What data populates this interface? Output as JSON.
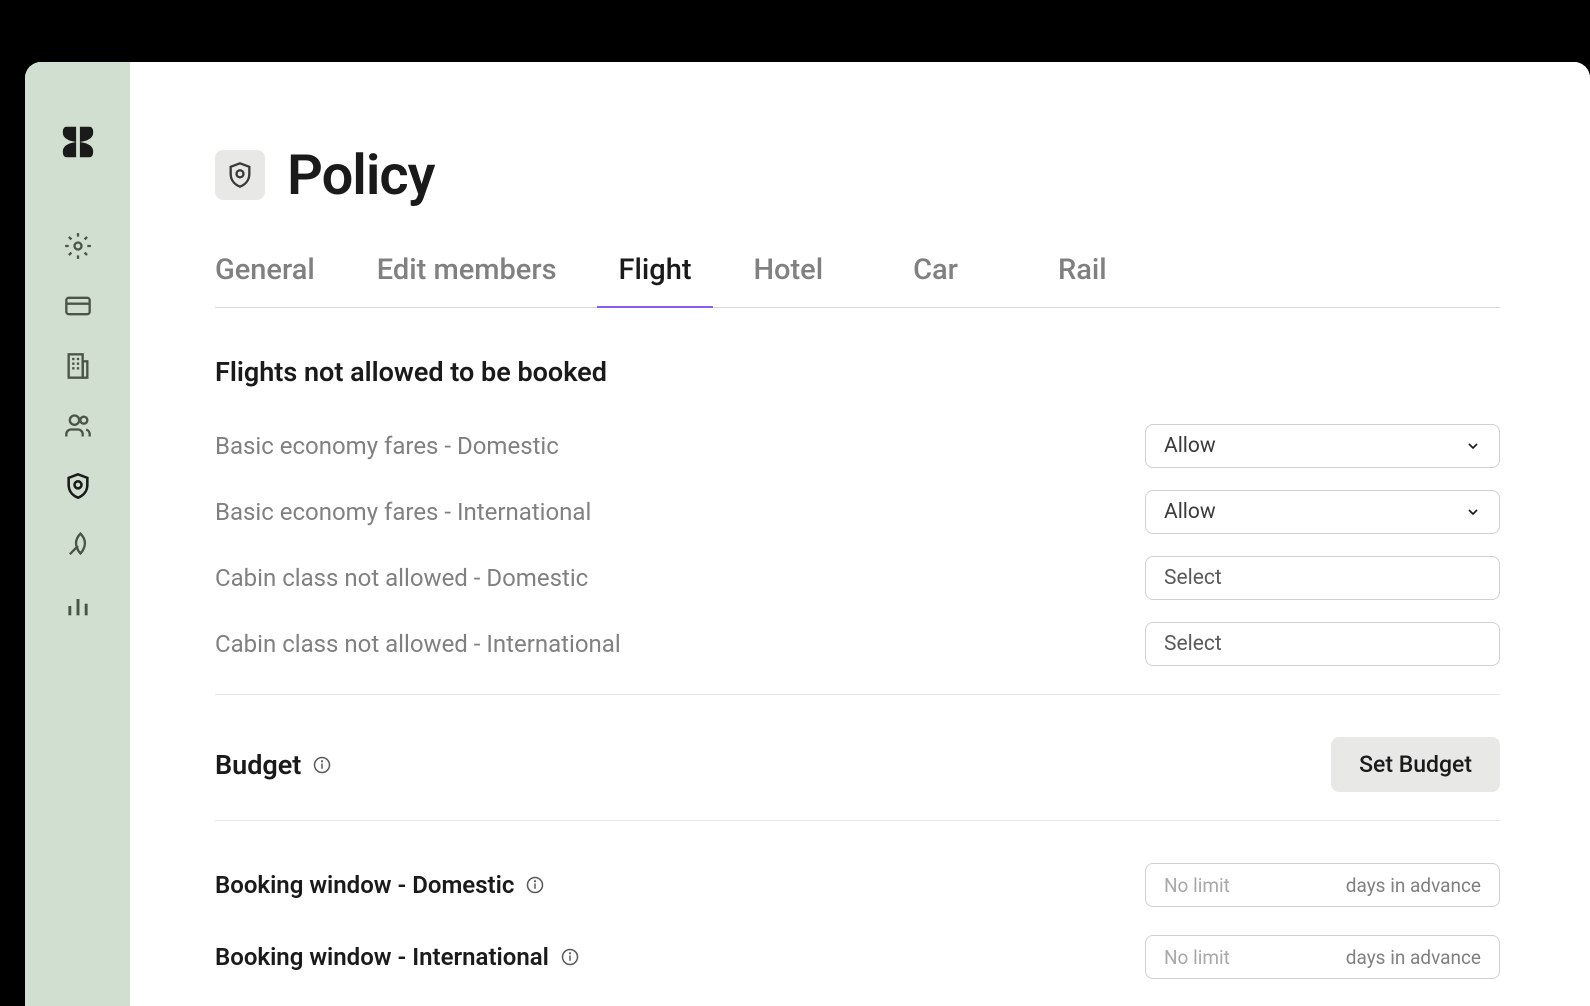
{
  "page": {
    "title": "Policy"
  },
  "tabs": [
    {
      "label": "General",
      "active": false
    },
    {
      "label": "Edit members",
      "active": false
    },
    {
      "label": "Flight",
      "active": true
    },
    {
      "label": "Hotel",
      "active": false
    },
    {
      "label": "Car",
      "active": false
    },
    {
      "label": "Rail",
      "active": false
    }
  ],
  "sections": {
    "not_allowed": {
      "title": "Flights not allowed to be booked",
      "rows": [
        {
          "label": "Basic economy fares - Domestic",
          "value": "Allow",
          "has_chevron": true
        },
        {
          "label": "Basic economy fares - International",
          "value": "Allow",
          "has_chevron": true
        },
        {
          "label": "Cabin class not allowed - Domestic",
          "value": "Select",
          "has_chevron": false
        },
        {
          "label": "Cabin class not allowed - International",
          "value": "Select",
          "has_chevron": false
        }
      ]
    },
    "budget": {
      "title": "Budget",
      "button": "Set Budget"
    },
    "booking_window": {
      "domestic_label": "Booking window - Domestic",
      "international_label": "Booking window - International",
      "placeholder": "No limit",
      "suffix": "days in advance"
    }
  }
}
